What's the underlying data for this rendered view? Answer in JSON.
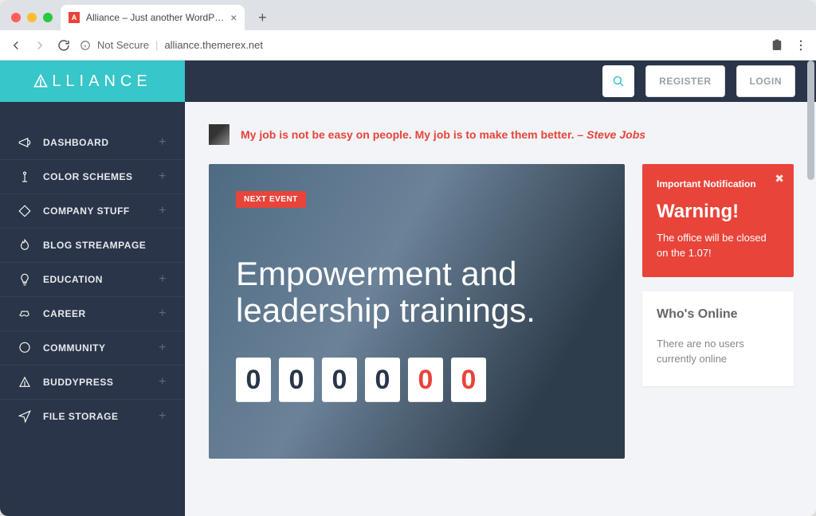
{
  "browser": {
    "tab_title": "Alliance – Just another WordP…",
    "not_secure": "Not Secure",
    "url": "alliance.themerex.net"
  },
  "brand": {
    "name": "LLIANCE"
  },
  "header": {
    "register": "REGISTER",
    "login": "LOGIN"
  },
  "sidebar": {
    "items": [
      {
        "label": "DASHBOARD",
        "expandable": true
      },
      {
        "label": "COLOR SCHEMES",
        "expandable": true
      },
      {
        "label": "COMPANY STUFF",
        "expandable": true
      },
      {
        "label": "BLOG STREAMPAGE",
        "expandable": false
      },
      {
        "label": "EDUCATION",
        "expandable": true
      },
      {
        "label": "CAREER",
        "expandable": true
      },
      {
        "label": "COMMUNITY",
        "expandable": true
      },
      {
        "label": "BUDDYPRESS",
        "expandable": true
      },
      {
        "label": "FILE STORAGE",
        "expandable": true
      }
    ]
  },
  "quote": {
    "text": "My job is not be easy on people. My job is to make them better.",
    "dash": " – ",
    "author": "Steve Jobs"
  },
  "hero": {
    "badge": "NEXT EVENT",
    "title": "Empowerment and leadership trainings.",
    "digits": [
      "0",
      "0",
      "0",
      "0",
      "0",
      "0"
    ]
  },
  "alert": {
    "label": "Important Notification",
    "title": "Warning!",
    "body": "The office will be closed on the 1.07!"
  },
  "online": {
    "title": "Who's Online",
    "body": "There are no users currently online"
  }
}
